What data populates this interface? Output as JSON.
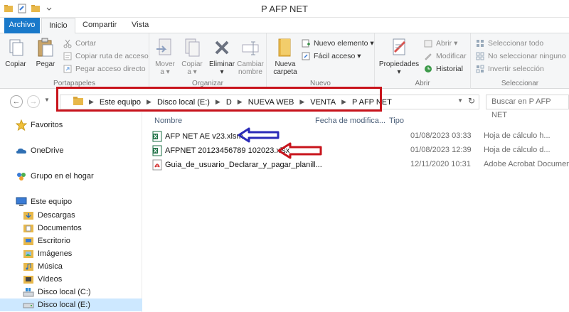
{
  "window": {
    "title": "P AFP NET"
  },
  "tabs": [
    {
      "label": "Archivo"
    },
    {
      "label": "Inicio"
    },
    {
      "label": "Compartir"
    },
    {
      "label": "Vista"
    }
  ],
  "ribbon": {
    "portapapeles": {
      "label": "Portapapeles",
      "copiar": "Copiar",
      "pegar": "Pegar",
      "cortar": "Cortar",
      "copiar_ruta": "Copiar ruta de acceso",
      "pegar_acceso": "Pegar acceso directo"
    },
    "organizar": {
      "label": "Organizar",
      "mover": "Mover",
      "mover_sub": "a ▾",
      "copiar": "Copiar",
      "copiar_sub": "a ▾",
      "eliminar": "Eliminar",
      "eliminar_sub": "▾",
      "cambiar": "Cambiar",
      "cambiar_sub": "nombre"
    },
    "nuevo": {
      "label": "Nuevo",
      "nueva_carpeta": "Nueva",
      "nueva_carpeta_sub": "carpeta",
      "nuevo_elemento": "Nuevo elemento ▾",
      "facil_acceso": "Fácil acceso ▾"
    },
    "abrir": {
      "label": "Abrir",
      "propiedades": "Propiedades",
      "propiedades_sub": "▾",
      "abrir": "Abrir ▾",
      "modificar": "Modificar",
      "historial": "Historial"
    },
    "seleccionar": {
      "label": "Seleccionar",
      "todo": "Seleccionar todo",
      "ninguno": "No seleccionar ninguno",
      "invertir": "Invertir selección"
    }
  },
  "address": {
    "crumbs": [
      "Este equipo",
      "Disco local (E:)",
      "D",
      "NUEVA WEB",
      "VENTA",
      "P AFP NET"
    ],
    "search_placeholder": "Buscar en P AFP NET"
  },
  "nav": {
    "favoritos": "Favoritos",
    "onedrive": "OneDrive",
    "grupo": "Grupo en el hogar",
    "equipo": "Este equipo",
    "items": [
      "Descargas",
      "Documentos",
      "Escritorio",
      "Imágenes",
      "Música",
      "Vídeos",
      "Disco local (C:)",
      "Disco local (E:)"
    ]
  },
  "columns": {
    "name": "Nombre",
    "date": "Fecha de modifica...",
    "type": "Tipo"
  },
  "files": [
    {
      "name": "AFP NET AE v23.xlsm",
      "date": "01/08/2023 03:33",
      "type": "Hoja de cálculo h...",
      "icon": "excel-icon"
    },
    {
      "name": "AFPNET 20123456789 102023.xlsx",
      "date": "01/08/2023 12:39",
      "type": "Hoja de cálculo d...",
      "icon": "excel-icon"
    },
    {
      "name": "Guia_de_usuario_Declarar_y_pagar_planill...",
      "date": "12/11/2020 10:31",
      "type": "Adobe Acrobat Document",
      "icon": "pdf-icon"
    }
  ],
  "colors": {
    "accent": "#1979ca",
    "annotation_red": "#c8141c",
    "annotation_blue": "#2b2bb8",
    "folder": "#e8b84a"
  }
}
